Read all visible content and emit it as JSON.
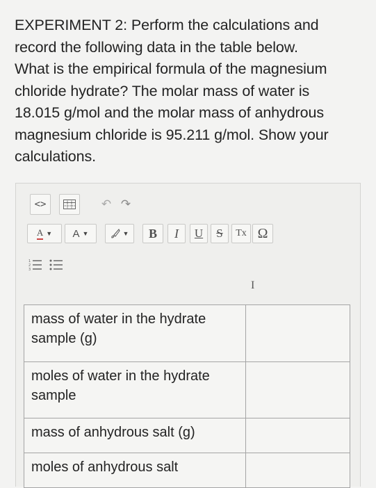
{
  "question": "EXPERIMENT 2: Perform the calculations and\nrecord the following data in the table below.\nWhat is the empirical formula of the magnesium\nchloride hydrate? The molar mass of water is\n18.015 g/mol and the molar mass of anhydrous\nmagnesium chloride is 95.211 g/mol. Show your\ncalculations.",
  "toolbar": {
    "source_icon": "<>",
    "table_icon": "table-icon",
    "undo_icon": "↶",
    "redo_icon": "↷",
    "font_color_label": "A",
    "bg_color_label": "A",
    "clear_format_icon": "brush-icon",
    "bold_label": "B",
    "italic_label": "I",
    "underline_label": "U",
    "strike_label": "S",
    "remove_format_label": "Tx",
    "special_char_label": "Ω",
    "ordered_list_icon": "ordered-list-icon",
    "unordered_list_icon": "bullet-list-icon"
  },
  "table": {
    "rows": [
      {
        "label": "mass of water in the hydrate sample (g)",
        "value": ""
      },
      {
        "label": "moles of water in the hydrate sample",
        "value": ""
      },
      {
        "label": "mass of anhydrous salt (g)",
        "value": ""
      },
      {
        "label": "moles of anhydrous salt",
        "value": ""
      }
    ]
  },
  "colors": {
    "background": "#f3f3f2",
    "text": "#232323",
    "border": "#a4a4a4"
  }
}
